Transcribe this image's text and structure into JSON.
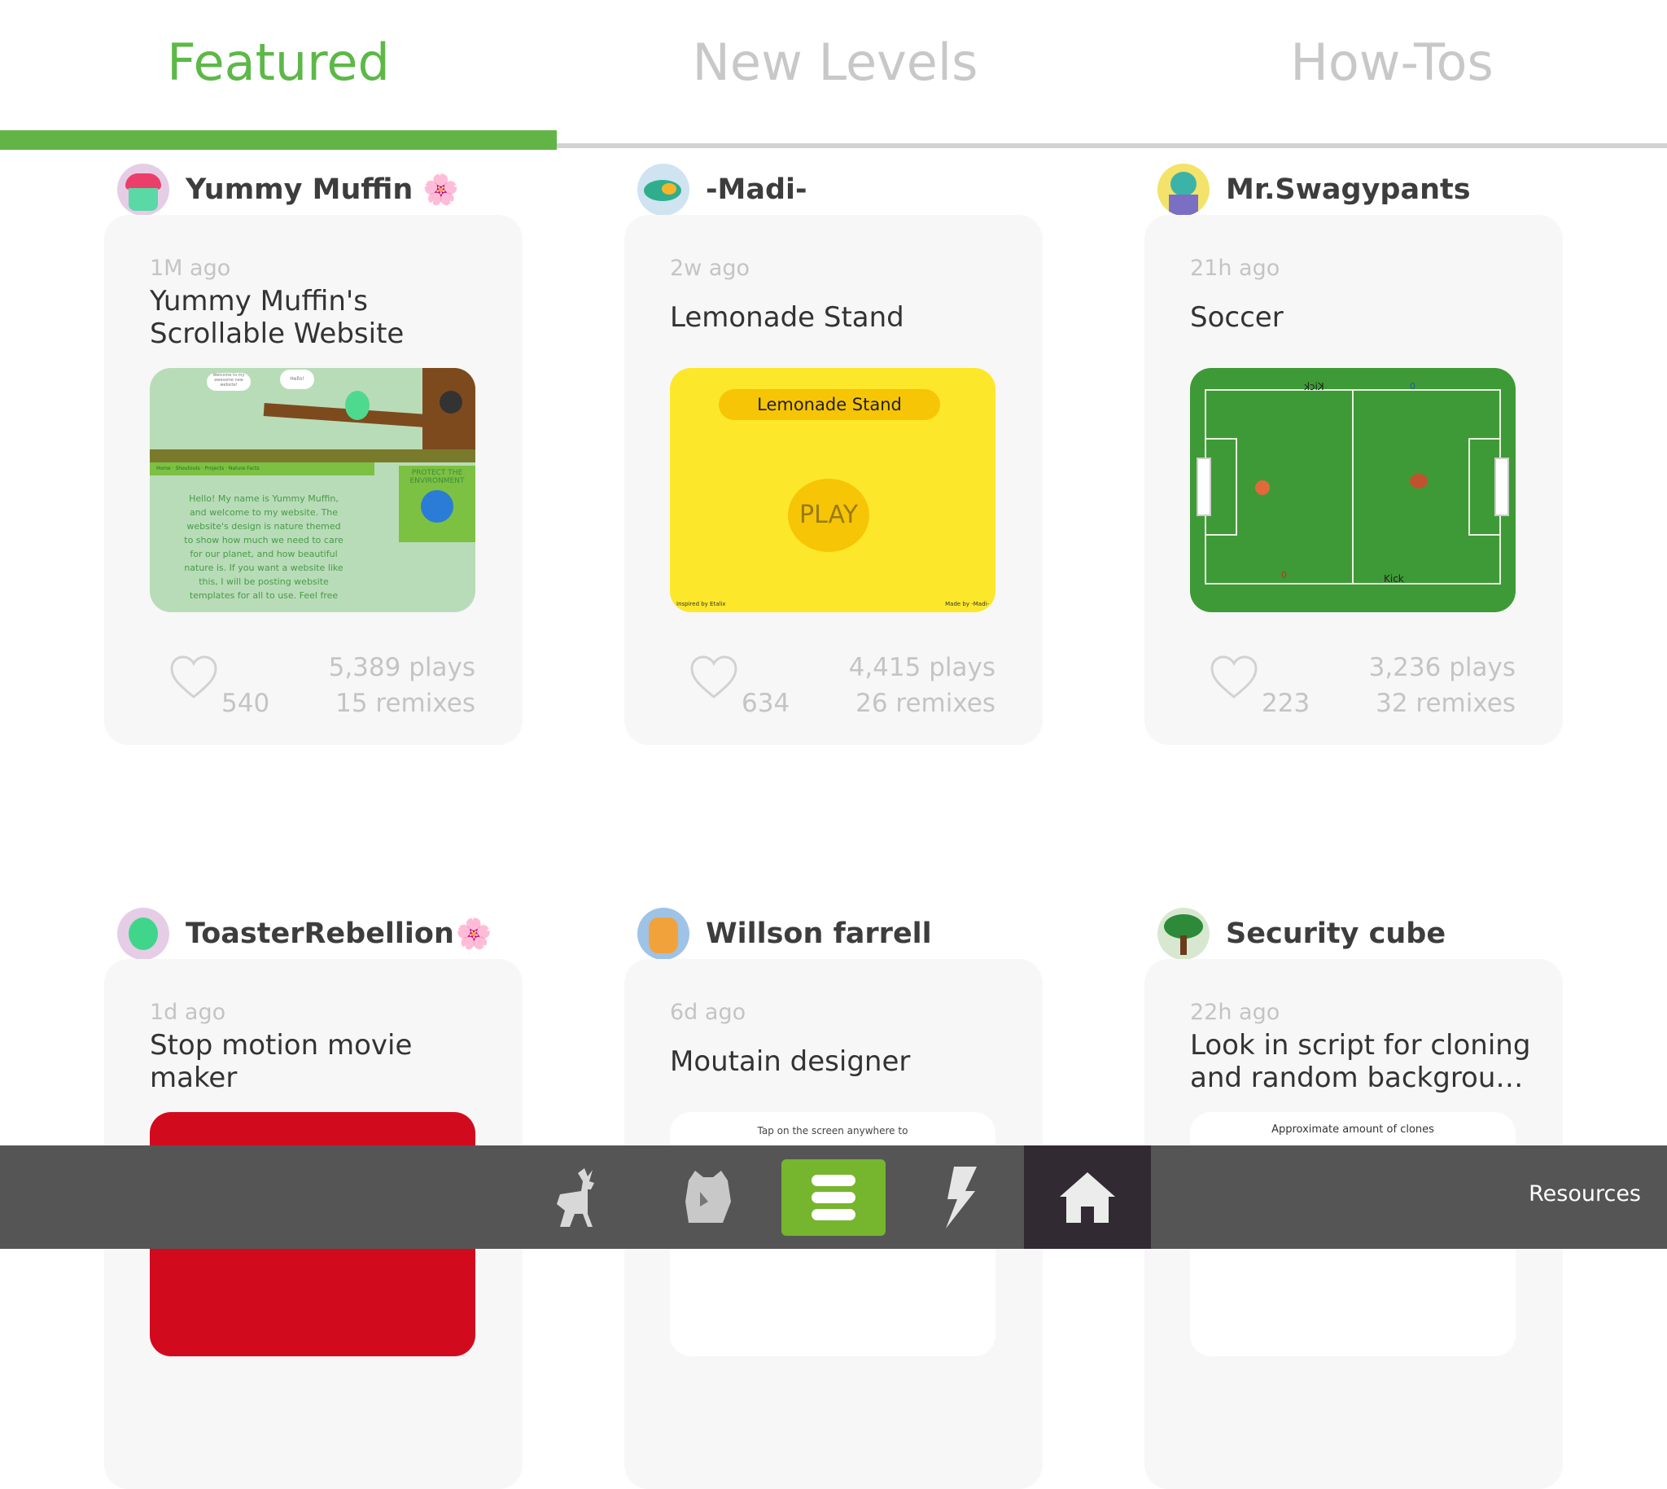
{
  "tabs": [
    {
      "label": "Featured",
      "active": true
    },
    {
      "label": "New Levels",
      "active": false
    },
    {
      "label": "How-Tos",
      "active": false
    }
  ],
  "accent": "#63b446",
  "cards": [
    {
      "user": "Yummy Muffin",
      "flower": "🌸",
      "time": "1M ago",
      "title": "Yummy Muffin's Scrollable Website",
      "likes": "540",
      "plays": "5,389 plays",
      "remixes": "15 remixes",
      "preview": {
        "nav": "Home · Shoutouts · Projects · Nature Facts",
        "side": "PROTECT THE ENVIRONMENT",
        "text": "Hello! My name is Yummy Muffin, and welcome to my website. The website's design is nature themed to show how much we need to care for our planet, and how beautiful nature is. If you want a website like this, I will be posting website templates for all to use. Feel free",
        "bubble1": "Welcome to my awesome new website!",
        "bubble2": "Hello!"
      }
    },
    {
      "user": "-Madi-",
      "time": "2w ago",
      "title": "Lemonade Stand",
      "likes": "634",
      "plays": "4,415 plays",
      "remixes": "26 remixes",
      "preview": {
        "banner": "Lemonade Stand",
        "play": "PLAY",
        "left": "Inspired by Etalix",
        "right": "Made by -Madi-"
      }
    },
    {
      "user": "Mr.Swagypants",
      "time": "21h ago",
      "title": "Soccer",
      "likes": "223",
      "plays": "3,236 plays",
      "remixes": "32 remixes",
      "preview": {
        "kick_top": "Kick",
        "kick_bottom": "Kick",
        "score_left": "0",
        "score_right": "0"
      }
    },
    {
      "user": "ToasterRebellion",
      "flower": "🌸",
      "time": "1d ago",
      "title": "Stop motion movie maker"
    },
    {
      "user": "Willson farrell",
      "time": "6d ago",
      "title": "Moutain designer",
      "preview_text": "Tap on the screen anywhere to"
    },
    {
      "user": "Security cube",
      "time": "22h ago",
      "title": "Look in script for cloning and random backgrou…",
      "preview_text": "Approximate amount of clones"
    }
  ],
  "bottom_nav": {
    "items": [
      "deer-icon",
      "raccoon-icon",
      "projects-icon",
      "bolt-icon",
      "home-icon"
    ],
    "selected": "projects-icon",
    "resources": "Resources"
  }
}
